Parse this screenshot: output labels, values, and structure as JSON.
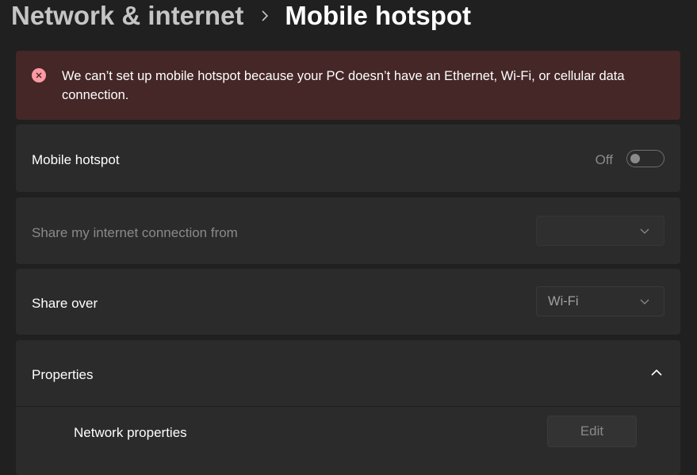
{
  "breadcrumb": {
    "parent": "Network & internet",
    "current": "Mobile hotspot"
  },
  "error": {
    "icon": "error-circle-icon",
    "message": "We can’t set up mobile hotspot because your PC doesn’t have an Ethernet, Wi-Fi, or cellular data connection."
  },
  "hotspot": {
    "label": "Mobile hotspot",
    "state_label": "Off",
    "enabled": false
  },
  "share_from": {
    "label": "Share my internet connection from",
    "value": ""
  },
  "share_over": {
    "label": "Share over",
    "value": "Wi-Fi"
  },
  "properties": {
    "label": "Properties",
    "expanded": true,
    "network_properties_label": "Network properties",
    "edit_label": "Edit"
  },
  "colors": {
    "background": "#202020",
    "card": "#2b2b2b",
    "error_banner": "#442726",
    "error_icon": "#ff99a4"
  }
}
